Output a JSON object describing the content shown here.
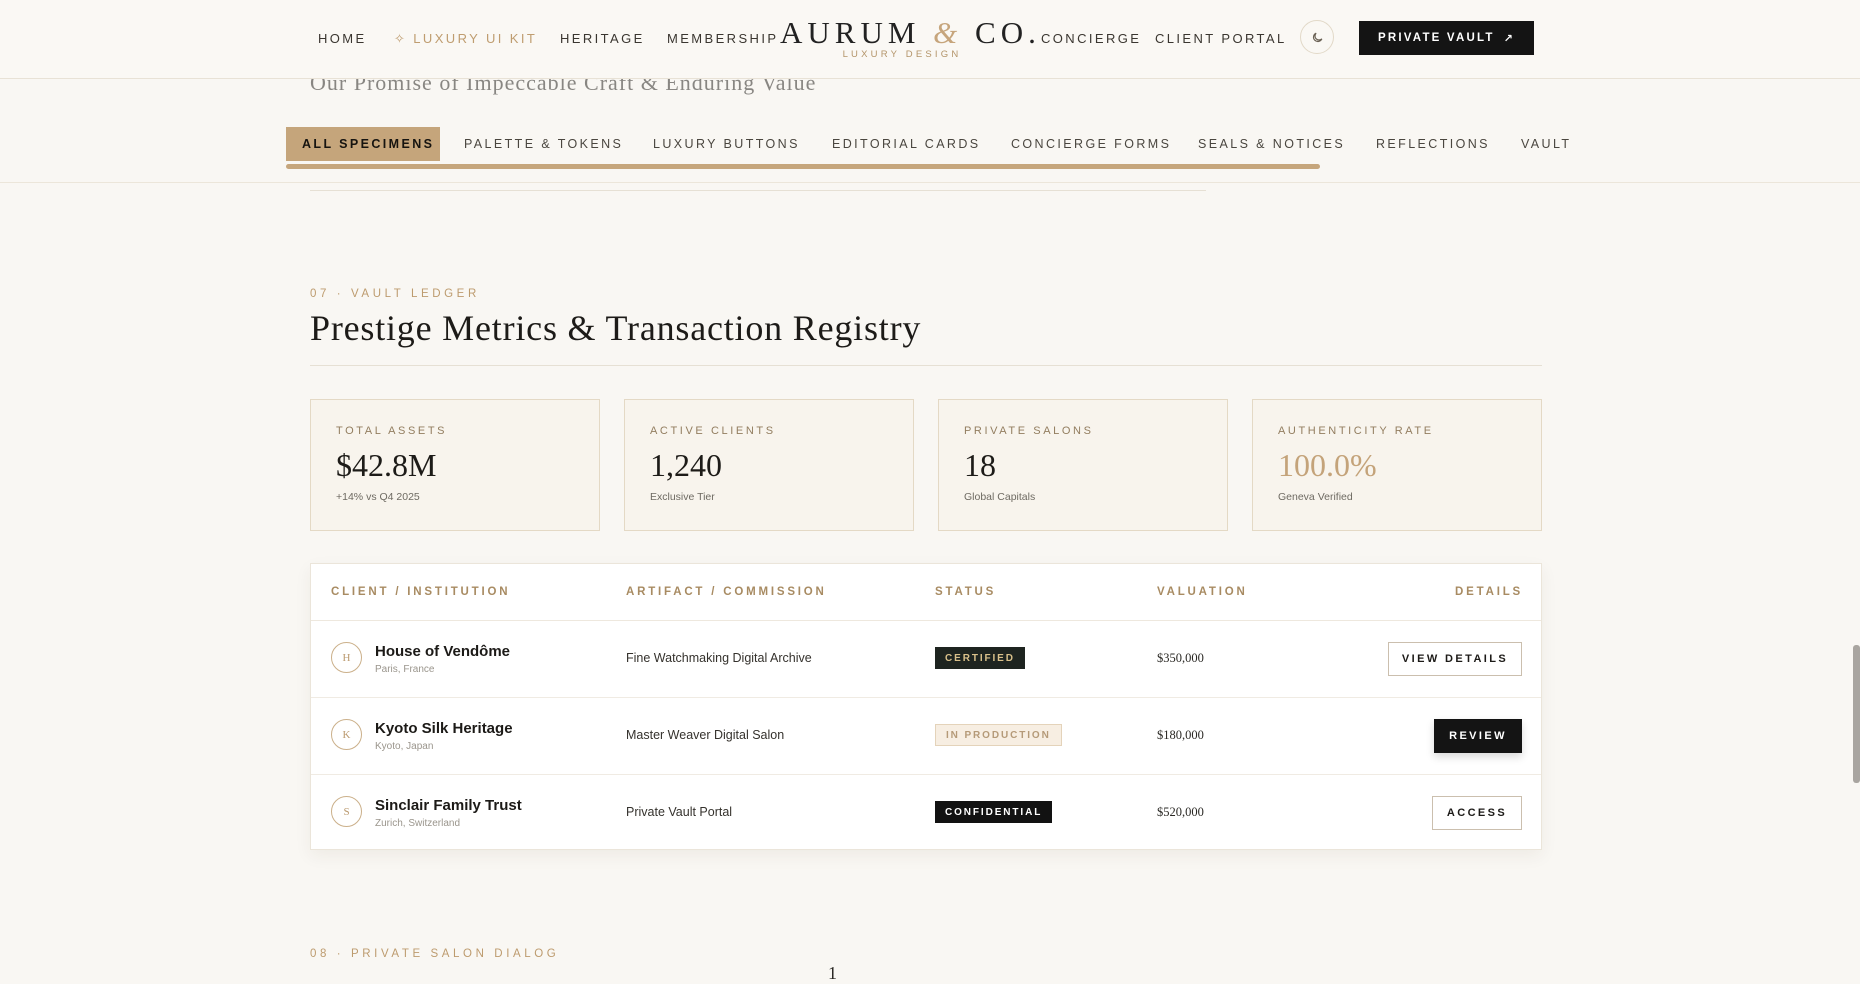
{
  "header": {
    "nav_left": [
      {
        "label": "HOME"
      },
      {
        "label": "LUXURY UI KIT"
      },
      {
        "label": "HERITAGE"
      },
      {
        "label": "MEMBERSHIP"
      }
    ],
    "logo": {
      "brand": "AURUM",
      "amp": "&",
      "suffix": "CO.",
      "tagline": "LUXURY DESIGN"
    },
    "nav_right": [
      {
        "label": "CONCIERGE"
      },
      {
        "label": "CLIENT PORTAL"
      }
    ],
    "theme_icon": "moon-icon",
    "cta": {
      "label": "PRIVATE VAULT",
      "icon": "arrow-up-right-icon"
    }
  },
  "specimen_tabs": {
    "ghost_heading": "Our Promise of Impeccable Craft & Enduring Value",
    "items": [
      {
        "label": "ALL SPECIMENS",
        "active": true
      },
      {
        "label": "PALETTE & TOKENS"
      },
      {
        "label": "LUXURY BUTTONS"
      },
      {
        "label": "EDITORIAL CARDS"
      },
      {
        "label": "CONCIERGE FORMS"
      },
      {
        "label": "SEALS & NOTICES"
      },
      {
        "label": "REFLECTIONS"
      },
      {
        "label": "VAULT"
      }
    ]
  },
  "section": {
    "eyebrow": "07 · VAULT LEDGER",
    "title": "Prestige Metrics & Transaction Registry"
  },
  "metrics": [
    {
      "label": "TOTAL ASSETS",
      "value": "$42.8M",
      "note": "+14% vs Q4 2025"
    },
    {
      "label": "ACTIVE CLIENTS",
      "value": "1,240",
      "note": "Exclusive Tier"
    },
    {
      "label": "PRIVATE SALONS",
      "value": "18",
      "note": "Global Capitals"
    },
    {
      "label": "AUTHENTICITY RATE",
      "value": "100.0%",
      "note": "Geneva Verified",
      "accent": "#c4a37a"
    }
  ],
  "ledger": {
    "columns": [
      "CLIENT / INSTITUTION",
      "ARTIFACT / COMMISSION",
      "STATUS",
      "VALUATION",
      "DETAILS"
    ],
    "rows": [
      {
        "initial": "H",
        "client": "House of Vendôme",
        "location": "Paris, France",
        "artifact": "Fine Watchmaking Digital Archive",
        "status": "CERTIFIED",
        "valuation": "$350,000",
        "action": "VIEW DETAILS"
      },
      {
        "initial": "K",
        "client": "Kyoto Silk Heritage",
        "location": "Kyoto, Japan",
        "artifact": "Master Weaver Digital Salon",
        "status": "IN PRODUCTION",
        "valuation": "$180,000",
        "action": "REVIEW"
      },
      {
        "initial": "S",
        "client": "Sinclair Family Trust",
        "location": "Zurich, Switzerland",
        "artifact": "Private Vault Portal",
        "status": "CONFIDENTIAL",
        "valuation": "$520,000",
        "action": "ACCESS"
      }
    ]
  },
  "next_section": {
    "eyebrow": "08 · PRIVATE SALON DIALOG",
    "glyph": "1"
  },
  "colors": {
    "gold": "#c5a57b",
    "ink": "#141414",
    "paper": "#f9f7f3"
  }
}
